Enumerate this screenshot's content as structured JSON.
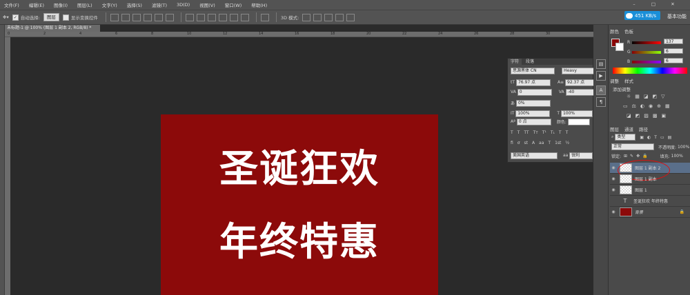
{
  "menu": [
    "文件(F)",
    "编辑(E)",
    "图像(I)",
    "图层(L)",
    "文字(Y)",
    "选择(S)",
    "滤镜(T)",
    "3D(D)",
    "视图(V)",
    "窗口(W)",
    "帮助(H)"
  ],
  "options_bar": {
    "auto_select_label": "自动选择:",
    "auto_select_value": "图层",
    "show_transform_label": "显示变换控件",
    "mode_3d_label": "3D 模式:"
  },
  "network_speed": "451 KB/s",
  "workspace": "基本功能",
  "doc_tab": "未标题-1 @ 100% (图层 1 副本 2, RGB/8) *",
  "ruler_ticks": [
    "0",
    "2",
    "4",
    "6",
    "8",
    "10",
    "12",
    "14",
    "16",
    "18",
    "20",
    "22",
    "24",
    "26",
    "28",
    "30"
  ],
  "document": {
    "line1": "圣诞狂欢",
    "line2": "年终特惠",
    "bg_color": "#8c0a0a"
  },
  "character_panel": {
    "tabs": [
      "字符",
      "段落"
    ],
    "font_family": "思源黑体 CN",
    "font_style": "Heavy",
    "font_size": "76.97 点",
    "leading": "92.37 点",
    "kerning": "0",
    "tracking": "-40",
    "tsume": "0%",
    "vertical_scale": "100%",
    "horizontal_scale": "100%",
    "baseline_shift": "0 点",
    "color_label": "颜色:",
    "language": "美国英语",
    "antialias": "锐利"
  },
  "color_panel": {
    "tabs": [
      "颜色",
      "色板"
    ],
    "r": "137",
    "g": "6",
    "b": "6"
  },
  "adjustments_panel": {
    "tabs": [
      "调整",
      "样式"
    ],
    "add_label": "添加调整"
  },
  "layers_panel": {
    "tabs": [
      "图层",
      "通道",
      "路径"
    ],
    "kind_label": "类型",
    "blend_mode": "正常",
    "opacity_label": "不透明度:",
    "opacity": "100%",
    "lock_label": "锁定:",
    "fill_label": "填充:",
    "fill": "100%",
    "layers": [
      "图层 1 副本 2",
      "图层 1 副本",
      "图层 1",
      "圣诞狂欢 年终特惠",
      "背景"
    ]
  }
}
